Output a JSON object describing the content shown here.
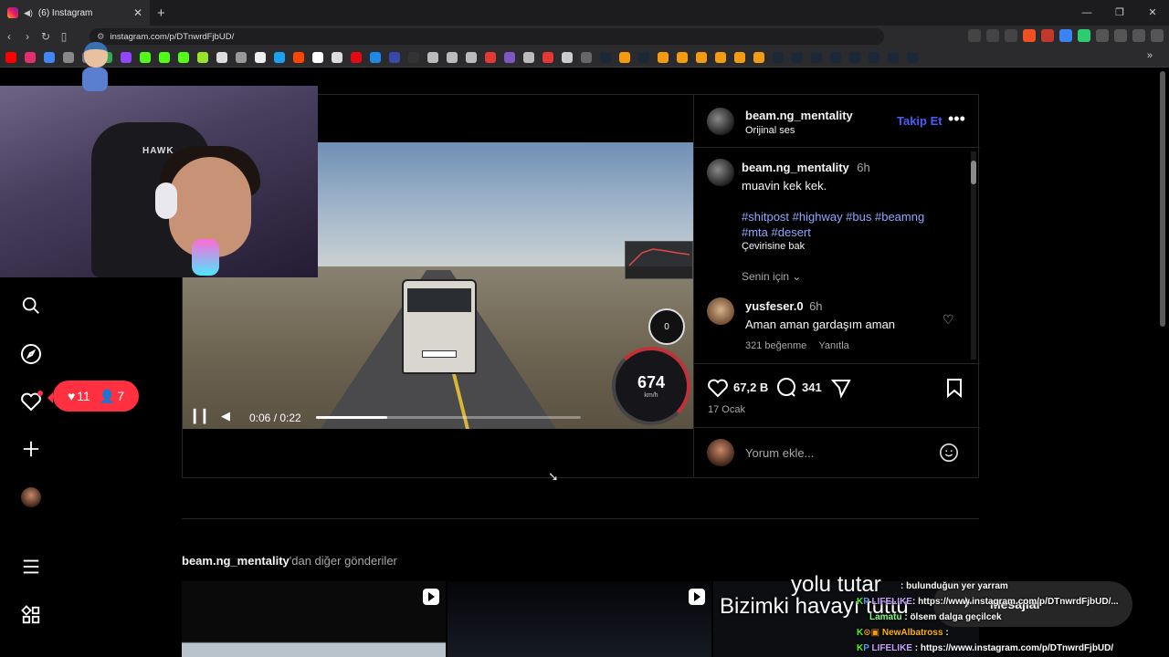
{
  "browser": {
    "tab_title": "(6) Instagram",
    "url": "instagram.com/p/DTnwrdFjbUD/",
    "new_tab": "+",
    "min": "—",
    "max": "❐",
    "close": "✕"
  },
  "webcam": {
    "chair_brand": "HAWK"
  },
  "nav": {
    "notifications": {
      "likes": "11",
      "followers": "7"
    }
  },
  "video": {
    "time": "0:06 / 0:22",
    "progress": 0.27,
    "speed": "674",
    "speed_unit": "km/h",
    "gear": "0"
  },
  "post": {
    "username": "beam.ng_mentality",
    "audio": "Orijinal ses",
    "follow_label": "Takip Et",
    "caption_user": "beam.ng_mentality",
    "caption_time": "6h",
    "caption_text": "muavin kek kek.",
    "hashtags_line1": "#shitpost #highway #bus #beamng",
    "hashtags_line2": "#mta #desert",
    "translate": "Çevirisine bak",
    "for_you": "Senin için",
    "comment": {
      "user": "yusfeser.0",
      "time": "6h",
      "text": "Aman aman gardaşım aman",
      "likes": "321 beğenme",
      "reply": "Yanıtla"
    },
    "like_count": "67,2 B",
    "comment_count": "341",
    "date": "17 Ocak",
    "add_comment_placeholder": "Yorum ekle..."
  },
  "more": {
    "user": "beam.ng_mentality",
    "suffix": "'dan diğer gönderiler"
  },
  "messages": {
    "label": "Mesajlar"
  },
  "stream_overlay": {
    "subtitle_line1": "yolu tutar",
    "subtitle_line2": "Bizimki havayı tuttu",
    "chat": [
      {
        "user": "",
        "text": ": bulunduğun yer yarram"
      },
      {
        "user": "LIFELIKE",
        "text": ": https://www.instagram.com/p/DTnwrdFjbUD/..."
      },
      {
        "user": "Lamatu",
        "text": ": ölsem dalga geçilcek"
      },
      {
        "user": "NewAlbatross",
        "text": ":"
      },
      {
        "user": "LIFELIKE",
        "text": ": https://www.instagram.com/p/DTnwrdFjbUD/"
      }
    ]
  },
  "colors": {
    "accent_blue": "#4a5df9",
    "notif_red": "#ff3040",
    "hashtag": "#8ea7ff"
  }
}
